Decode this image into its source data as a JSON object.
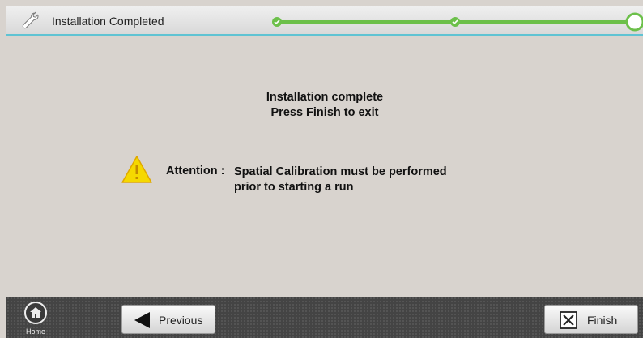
{
  "header": {
    "title": "Installation Completed",
    "wrench_icon": "wrench-icon",
    "progress_steps": [
      {
        "state": "completed"
      },
      {
        "state": "completed"
      },
      {
        "state": "current"
      }
    ],
    "accent_color": "#6cc04a",
    "underline_color": "#5fc3d3"
  },
  "main": {
    "message_line1": "Installation complete",
    "message_line2": "Press Finish to exit",
    "attention_label": "Attention :",
    "attention_line1": "Spatial Calibration must be performed",
    "attention_line2": "prior to starting a run",
    "warning_icon": "warning-triangle-icon"
  },
  "footer": {
    "home_label": "Home",
    "previous_label": "Previous",
    "finish_label": "Finish"
  }
}
